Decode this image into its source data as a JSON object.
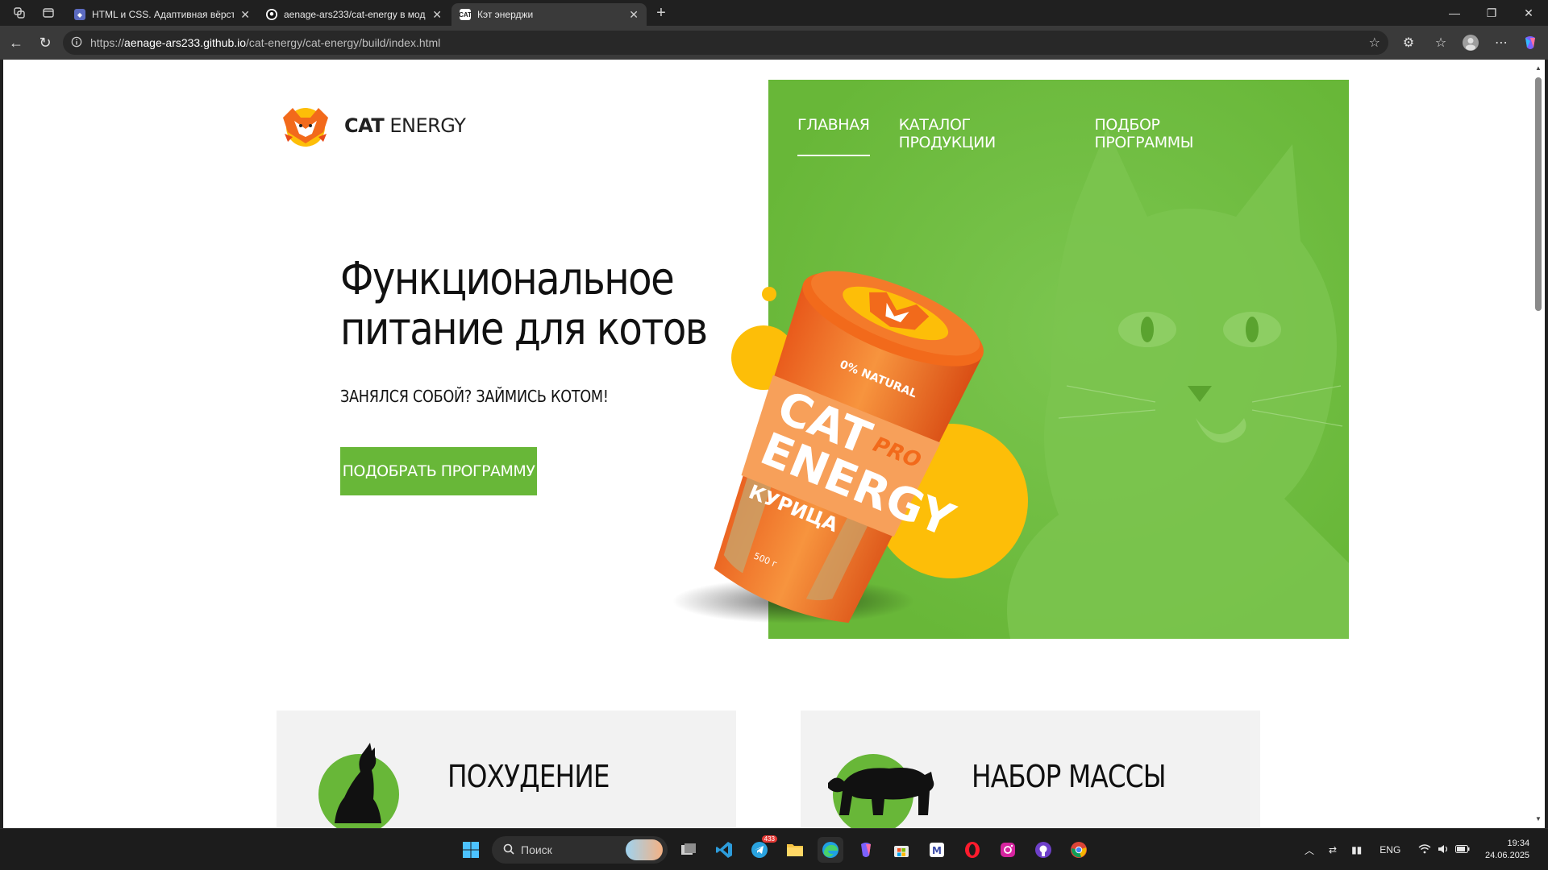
{
  "browser": {
    "tabs": [
      {
        "title": "HTML и CSS. Адаптивная вёрстка",
        "favicon": "shield-favicon"
      },
      {
        "title": "aenage-ars233/cat-energy в мод",
        "favicon": "github-favicon"
      },
      {
        "title": "Кэт энерджи",
        "favicon": "cat-favicon",
        "favicon_text": "CAT"
      }
    ],
    "new_tab_label": "+",
    "url_prefix": "https://",
    "url_host": "aenage-ars233.github.io",
    "url_path": "/cat-energy/cat-energy/build/index.html"
  },
  "page": {
    "logo": {
      "bold": "CAT",
      "regular": "ENERGY"
    },
    "nav": [
      "ГЛАВНАЯ",
      "КАТАЛОГ ПРОДУКЦИИ",
      "ПОДБОР ПРОГРАММЫ"
    ],
    "hero": {
      "title_line1": "Функциональное",
      "title_line2": "питание для котов",
      "subtitle": "ЗАНЯЛСЯ СОБОЙ? ЗАЙМИСЬ КОТОМ!",
      "cta": "ПОДОБРАТЬ ПРОГРАММУ"
    },
    "product": {
      "natural": "0% NATURAL",
      "brand_line1": "CAT",
      "brand_line2": "ENERGY",
      "pro": "PRO",
      "flavor": "КУРИЦА",
      "weight": "500 г"
    },
    "cards": [
      {
        "title": "ПОХУДЕНИЕ"
      },
      {
        "title": "НАБОР МАССЫ"
      }
    ]
  },
  "taskbar": {
    "search_placeholder": "Поиск",
    "telegram_badge": "433",
    "language": "ENG",
    "time": "19:34",
    "date": "24.06.2025"
  },
  "colors": {
    "brand_green": "#68b738",
    "brand_orange": "#f26a1b",
    "brand_yellow": "#fdbe08"
  }
}
